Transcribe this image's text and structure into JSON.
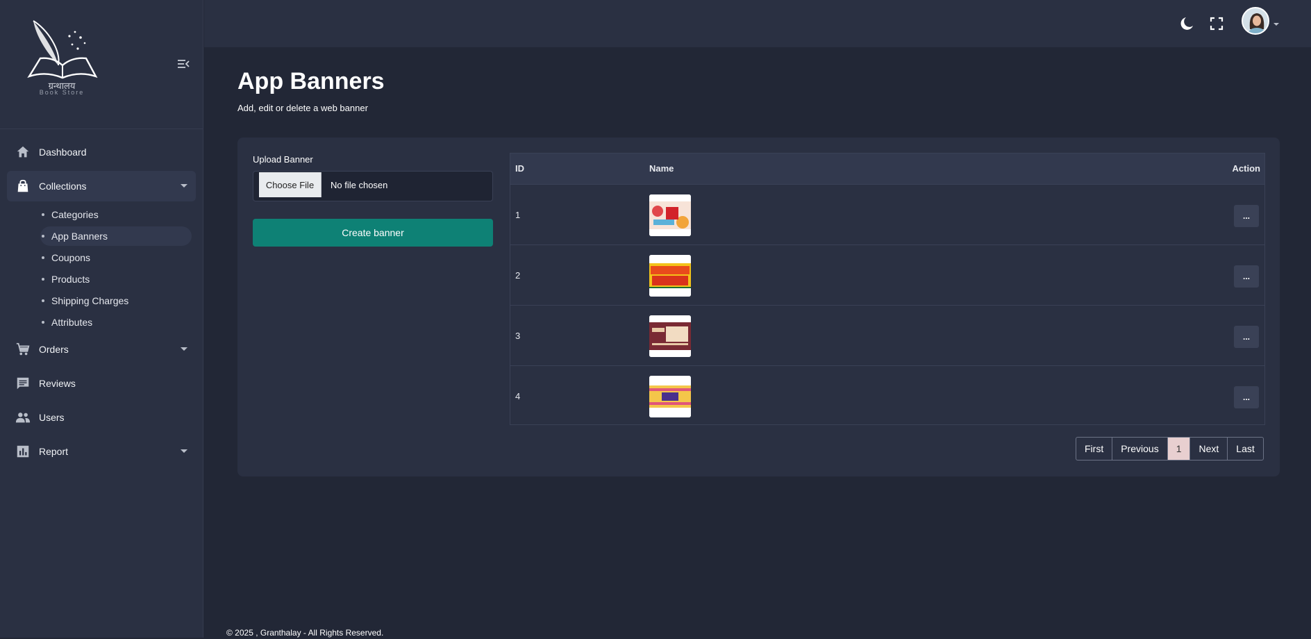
{
  "brand": {
    "title": "ग्रन्थालय",
    "subtitle": "Book Store"
  },
  "sidebar": {
    "items": [
      {
        "label": "Dashboard",
        "icon": "home-icon"
      },
      {
        "label": "Collections",
        "icon": "shopping-bag-icon"
      },
      {
        "label": "Orders",
        "icon": "shopping-cart-icon"
      },
      {
        "label": "Reviews",
        "icon": "comment-icon"
      },
      {
        "label": "Users",
        "icon": "users-icon"
      },
      {
        "label": "Report",
        "icon": "bar-chart-icon"
      }
    ],
    "collections_sub": [
      "Categories",
      "App Banners",
      "Coupons",
      "Products",
      "Shipping Charges",
      "Attributes"
    ]
  },
  "header": {
    "icons": [
      "theme-toggle-icon",
      "fullscreen-icon"
    ]
  },
  "page": {
    "title": "App Banners",
    "subtitle": "Add, edit or delete a web banner"
  },
  "upload": {
    "label": "Upload Banner",
    "button": "Choose File",
    "status": "No file chosen",
    "create": "Create banner"
  },
  "table": {
    "headers": [
      "ID",
      "Name",
      "Action"
    ],
    "rows": [
      {
        "id": "1",
        "action": "..."
      },
      {
        "id": "2",
        "action": "..."
      },
      {
        "id": "3",
        "action": "..."
      },
      {
        "id": "4",
        "action": "..."
      }
    ]
  },
  "pagination": [
    "First",
    "Previous",
    "1",
    "Next",
    "Last"
  ],
  "footer": "© 2025 , Granthalay - All Rights Reserved.",
  "colors": {
    "accent": "#0e8175",
    "page_bg": "#222736",
    "panel_bg": "#2a3042"
  }
}
